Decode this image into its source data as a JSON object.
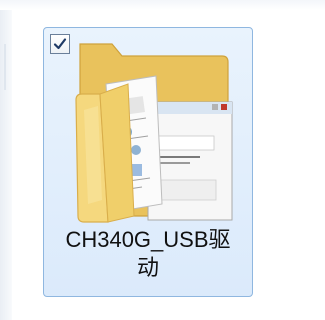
{
  "item": {
    "name_line1": "CH340G_USB驱",
    "name_line2": "动",
    "selected": true,
    "checked": true,
    "icon": "folder-icon"
  },
  "colors": {
    "selection_fill": "#dbeafb",
    "selection_border": "#8fb7e0",
    "folder_yellow": "#f2d173",
    "folder_dark": "#d9ae4b"
  }
}
